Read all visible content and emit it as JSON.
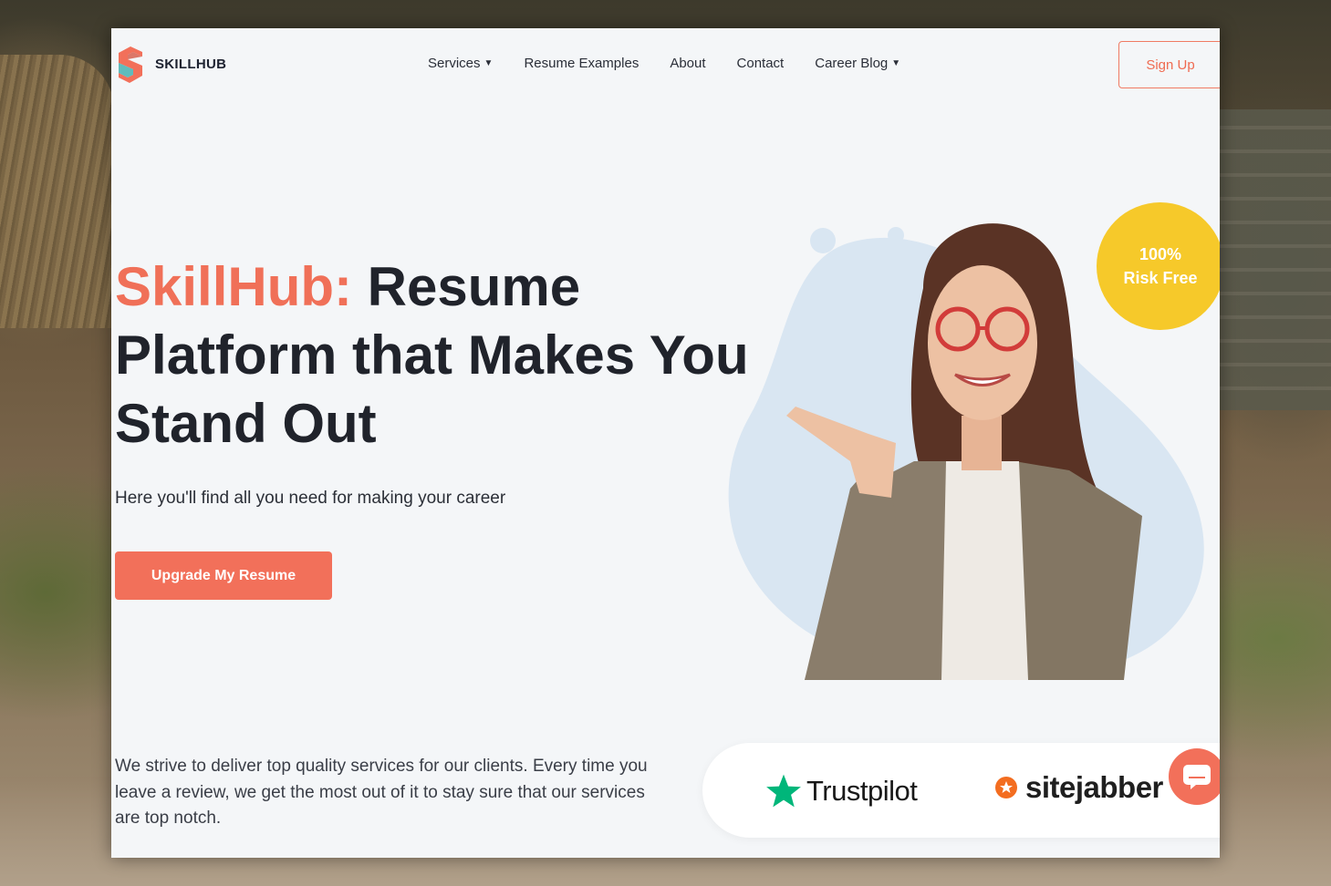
{
  "brand": {
    "name": "SKILLHUB",
    "accent_color": "#f2705a",
    "logo_icon": "skillhub-s-logo-icon"
  },
  "nav": {
    "items": [
      {
        "label": "Services",
        "has_dropdown": true
      },
      {
        "label": "Resume Examples",
        "has_dropdown": false
      },
      {
        "label": "About",
        "has_dropdown": false
      },
      {
        "label": "Contact",
        "has_dropdown": false
      },
      {
        "label": "Career Blog",
        "has_dropdown": true
      }
    ],
    "signup_label": "Sign Up"
  },
  "hero": {
    "headline_brand": "SkillHub:",
    "headline_rest": " Resume Platform that Makes You Stand Out",
    "subtitle": "Here you'll find all you need for making your career",
    "cta_label": "Upgrade My Resume",
    "badge_line1": "100%",
    "badge_line2": "Risk Free",
    "badge_color": "#f6c92a",
    "image": "woman-pointing-photo"
  },
  "reviews": {
    "text": "We strive to deliver top quality services for our clients. Every time you leave a review, we get the most out of it to stay sure that our services are top notch.",
    "trustpilot_label": "Trustpilot",
    "sitejabber_label": "sitejabber",
    "trustpilot_icon": "star-icon",
    "sitejabber_icon": "sitejabber-badge-icon"
  },
  "chat": {
    "icon": "chat-bubble-icon"
  }
}
